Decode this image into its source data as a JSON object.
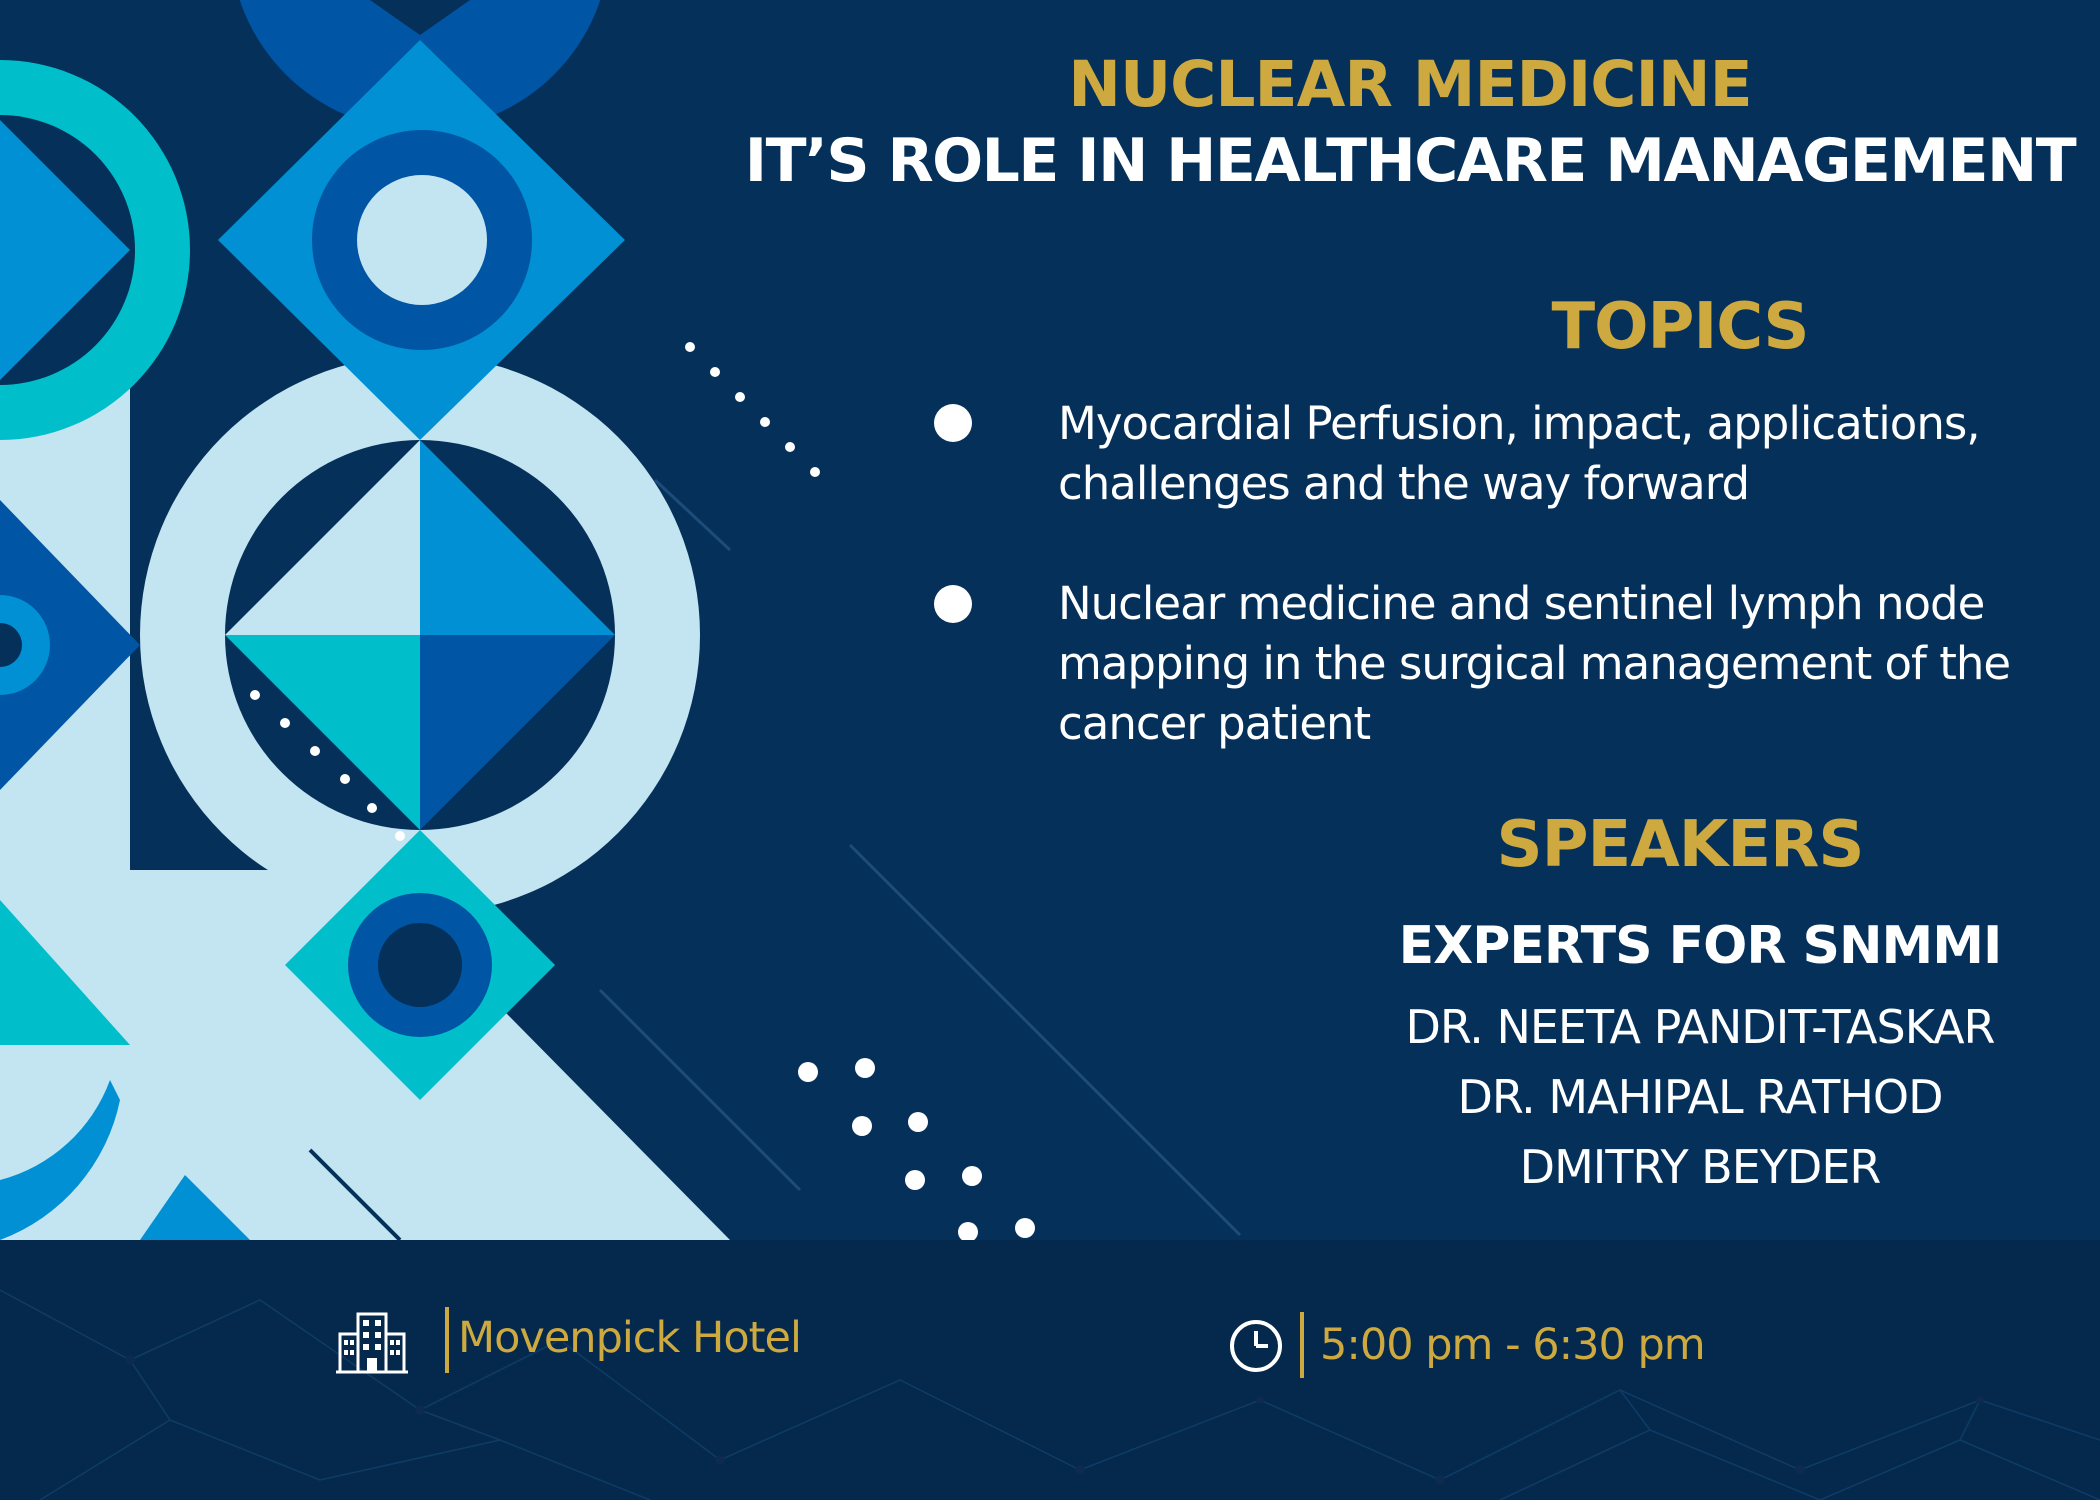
{
  "header": {
    "title": "NUCLEAR MEDICINE",
    "subtitle": "IT’S ROLE IN HEALTHCARE MANAGEMENT"
  },
  "topics": {
    "heading": "TOPICS",
    "items": [
      {
        "line1": "Myocardial Perfusion, impact, applications,",
        "line2": "challenges and the way forward",
        "line3": ""
      },
      {
        "line1": "Nuclear medicine and sentinel lymph node",
        "line2": "mapping in the surgical management of the",
        "line3": "cancer patient"
      }
    ]
  },
  "speakers": {
    "heading": "SPEAKERS",
    "group": "EXPERTS FOR SNMMI",
    "names": [
      "DR. NEETA PANDIT-TASKAR",
      "DR. MAHIPAL RATHOD",
      "DMITRY BEYDER"
    ]
  },
  "footer": {
    "venue": "Movenpick Hotel",
    "time": "5:00 pm - 6:30 pm",
    "venue_icon": "hotel-building-icon",
    "time_icon": "clock-icon"
  },
  "colors": {
    "background": "#053059",
    "footer_background": "#04294d",
    "gold": "#cda93f",
    "cyan": "#00bfcb",
    "light_blue": "#c3e5f2",
    "mid_blue": "#0090d3",
    "royal_blue": "#0055a4",
    "text": "#ffffff"
  }
}
